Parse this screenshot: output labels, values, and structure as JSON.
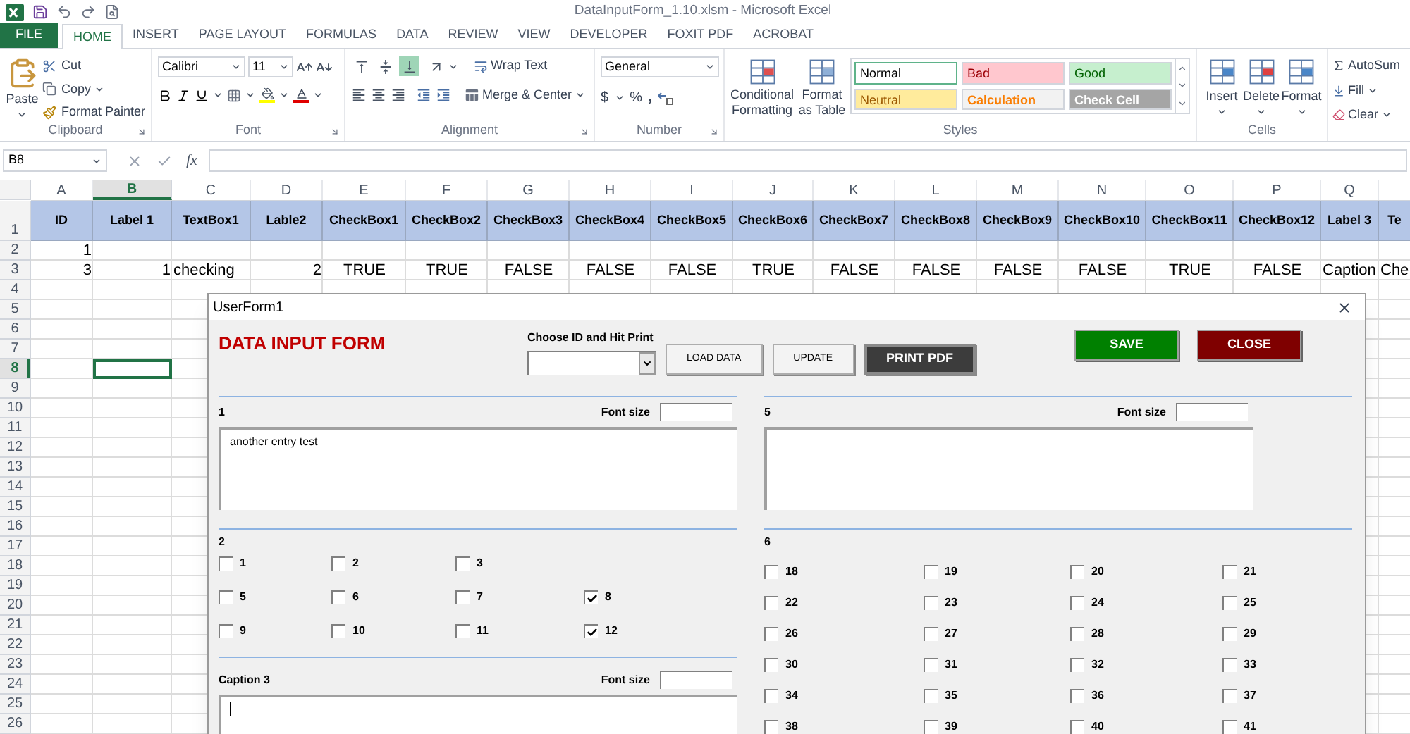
{
  "title_bar": {
    "title": "DataInputForm_1.10.xlsm - Microsoft Excel"
  },
  "ribbon_tabs": [
    {
      "label": "FILE",
      "kind": "file",
      "selected": false
    },
    {
      "label": "HOME",
      "kind": "tab",
      "selected": true
    },
    {
      "label": "INSERT",
      "kind": "tab",
      "selected": false
    },
    {
      "label": "PAGE LAYOUT",
      "kind": "tab",
      "selected": false
    },
    {
      "label": "FORMULAS",
      "kind": "tab",
      "selected": false
    },
    {
      "label": "DATA",
      "kind": "tab",
      "selected": false
    },
    {
      "label": "REVIEW",
      "kind": "tab",
      "selected": false
    },
    {
      "label": "VIEW",
      "kind": "tab",
      "selected": false
    },
    {
      "label": "DEVELOPER",
      "kind": "tab",
      "selected": false
    },
    {
      "label": "FOXIT PDF",
      "kind": "tab",
      "selected": false
    },
    {
      "label": "ACROBAT",
      "kind": "tab",
      "selected": false
    }
  ],
  "ribbon": {
    "clipboard": {
      "label": "Clipboard",
      "paste": "Paste",
      "cut": "Cut",
      "copy": "Copy",
      "format_painter": "Format Painter"
    },
    "font": {
      "label": "Font",
      "name": "Calibri",
      "size": "11"
    },
    "alignment": {
      "label": "Alignment",
      "wrap_text": "Wrap Text",
      "merge": "Merge & Center",
      "vertical_buttons": [
        {
          "kind": "top",
          "selected": false
        },
        {
          "kind": "middle",
          "selected": false
        },
        {
          "kind": "bottom",
          "selected": true
        }
      ]
    },
    "number": {
      "label": "Number",
      "format": "General",
      "currency": "$",
      "percent": "%",
      "comma": ","
    },
    "styles": {
      "label": "Styles",
      "conditional": "Conditional Formatting",
      "format_table": "Format as Table",
      "gallery": [
        {
          "label": "Normal",
          "kind": "normal",
          "selected": true
        },
        {
          "label": "Bad",
          "kind": "bad",
          "selected": false
        },
        {
          "label": "Good",
          "kind": "good",
          "selected": false
        },
        {
          "label": "Neutral",
          "kind": "neutral",
          "selected": false
        },
        {
          "label": "Calculation",
          "kind": "calculation",
          "selected": false
        },
        {
          "label": "Check Cell",
          "kind": "check",
          "selected": false
        }
      ]
    },
    "cells": {
      "label": "Cells",
      "insert": "Insert",
      "delete": "Delete",
      "format": "Format"
    },
    "editing": {
      "autosum": "AutoSum",
      "fill": "Fill",
      "clear": "Clear"
    }
  },
  "formula_bar": {
    "name_box": "B8",
    "fx": "fx"
  },
  "sheet": {
    "columns": [
      {
        "letter": "A",
        "selected": false
      },
      {
        "letter": "B",
        "selected": true
      },
      {
        "letter": "C",
        "selected": false
      },
      {
        "letter": "D",
        "selected": false
      },
      {
        "letter": "E",
        "selected": false
      },
      {
        "letter": "F",
        "selected": false
      },
      {
        "letter": "G",
        "selected": false
      },
      {
        "letter": "H",
        "selected": false
      },
      {
        "letter": "I",
        "selected": false
      },
      {
        "letter": "J",
        "selected": false
      },
      {
        "letter": "K",
        "selected": false
      },
      {
        "letter": "L",
        "selected": false
      },
      {
        "letter": "M",
        "selected": false
      },
      {
        "letter": "N",
        "selected": false
      },
      {
        "letter": "O",
        "selected": false
      },
      {
        "letter": "P",
        "selected": false
      },
      {
        "letter": "Q",
        "selected": false
      }
    ],
    "rows": [
      {
        "number": "1",
        "selected": false,
        "cells": [
          {
            "text": "ID",
            "kind": "header"
          },
          {
            "text": "Label 1",
            "kind": "header"
          },
          {
            "text": "TextBox1",
            "kind": "header"
          },
          {
            "text": "Lable2",
            "kind": "header"
          },
          {
            "text": "CheckBox1",
            "kind": "header"
          },
          {
            "text": "CheckBox2",
            "kind": "header"
          },
          {
            "text": "CheckBox3",
            "kind": "header"
          },
          {
            "text": "CheckBox4",
            "kind": "header"
          },
          {
            "text": "CheckBox5",
            "kind": "header"
          },
          {
            "text": "CheckBox6",
            "kind": "header"
          },
          {
            "text": "CheckBox7",
            "kind": "header"
          },
          {
            "text": "CheckBox8",
            "kind": "header"
          },
          {
            "text": "CheckBox9",
            "kind": "header"
          },
          {
            "text": "CheckBox10",
            "kind": "header"
          },
          {
            "text": "CheckBox11",
            "kind": "header"
          },
          {
            "text": "CheckBox12",
            "kind": "header"
          },
          {
            "text": "Label 3",
            "kind": "header"
          },
          {
            "text": "Te",
            "kind": "header"
          }
        ]
      },
      {
        "number": "2",
        "selected": false,
        "cells": [
          {
            "text": "1",
            "kind": "number"
          }
        ]
      },
      {
        "number": "3",
        "selected": false,
        "cells": [
          {
            "text": "3",
            "kind": "number"
          },
          {
            "text": "1",
            "kind": "number"
          },
          {
            "text": "checking",
            "kind": "text"
          },
          {
            "text": "2",
            "kind": "number"
          },
          {
            "text": "TRUE",
            "kind": "boolean"
          },
          {
            "text": "TRUE",
            "kind": "boolean"
          },
          {
            "text": "FALSE",
            "kind": "boolean"
          },
          {
            "text": "FALSE",
            "kind": "boolean"
          },
          {
            "text": "FALSE",
            "kind": "boolean"
          },
          {
            "text": "TRUE",
            "kind": "boolean"
          },
          {
            "text": "FALSE",
            "kind": "boolean"
          },
          {
            "text": "FALSE",
            "kind": "boolean"
          },
          {
            "text": "FALSE",
            "kind": "boolean"
          },
          {
            "text": "FALSE",
            "kind": "boolean"
          },
          {
            "text": "TRUE",
            "kind": "boolean"
          },
          {
            "text": "FALSE",
            "kind": "boolean"
          },
          {
            "text": "Caption",
            "kind": "text"
          },
          {
            "text": "Che",
            "kind": "text"
          }
        ]
      },
      {
        "number": "4",
        "selected": false
      },
      {
        "number": "5",
        "selected": false
      },
      {
        "number": "6",
        "selected": false
      },
      {
        "number": "7",
        "selected": false
      },
      {
        "number": "8",
        "selected": true
      },
      {
        "number": "9",
        "selected": false
      },
      {
        "number": "10",
        "selected": false
      },
      {
        "number": "11",
        "selected": false
      },
      {
        "number": "12",
        "selected": false
      },
      {
        "number": "13",
        "selected": false
      },
      {
        "number": "14",
        "selected": false
      },
      {
        "number": "15",
        "selected": false
      },
      {
        "number": "16",
        "selected": false
      },
      {
        "number": "17",
        "selected": false
      },
      {
        "number": "18",
        "selected": false
      },
      {
        "number": "19",
        "selected": false
      },
      {
        "number": "20",
        "selected": false
      },
      {
        "number": "21",
        "selected": false
      },
      {
        "number": "22",
        "selected": false
      },
      {
        "number": "23",
        "selected": false
      },
      {
        "number": "24",
        "selected": false
      },
      {
        "number": "25",
        "selected": false
      },
      {
        "number": "26",
        "selected": false
      }
    ]
  },
  "userform": {
    "title": "UserForm1",
    "heading": "DATA INPUT FORM",
    "choose_label": "Choose ID and Hit Print",
    "buttons": [
      {
        "label": "LOAD DATA",
        "kind": "plain"
      },
      {
        "label": "UPDATE",
        "kind": "plain"
      },
      {
        "label": "PRINT PDF",
        "kind": "dark"
      }
    ],
    "save": "SAVE",
    "close": "CLOSE",
    "left_column": [
      {
        "kind": "text",
        "caption": "1",
        "font_size_label": "Font size",
        "value": "another entry test",
        "focused": false
      },
      {
        "kind": "checkboxes",
        "caption": "2",
        "rows": [
          [
            {
              "label": "1",
              "checked": false
            },
            {
              "label": "2",
              "checked": false
            },
            {
              "label": "3",
              "checked": false
            }
          ],
          [
            {
              "label": "5",
              "checked": false
            },
            {
              "label": "6",
              "checked": false
            },
            {
              "label": "7",
              "checked": false
            },
            {
              "label": "8",
              "checked": true
            }
          ],
          [
            {
              "label": "9",
              "checked": false
            },
            {
              "label": "10",
              "checked": false
            },
            {
              "label": "11",
              "checked": false
            },
            {
              "label": "12",
              "checked": true
            }
          ]
        ]
      },
      {
        "kind": "text",
        "caption": "Caption 3",
        "font_size_label": "Font size",
        "focused": true
      }
    ],
    "right_column": [
      {
        "kind": "text",
        "caption": "5",
        "font_size_label": "Font size",
        "focused": false
      },
      {
        "kind": "checkboxes",
        "caption": "6",
        "rows": [
          [
            {
              "label": "18",
              "checked": false
            },
            {
              "label": "19",
              "checked": false
            },
            {
              "label": "20",
              "checked": false
            },
            {
              "label": "21",
              "checked": false
            }
          ],
          [
            {
              "label": "22",
              "checked": false
            },
            {
              "label": "23",
              "checked": false
            },
            {
              "label": "24",
              "checked": false
            },
            {
              "label": "25",
              "checked": false
            }
          ],
          [
            {
              "label": "26",
              "checked": false
            },
            {
              "label": "27",
              "checked": false
            },
            {
              "label": "28",
              "checked": false
            },
            {
              "label": "29",
              "checked": false
            }
          ],
          [
            {
              "label": "30",
              "checked": false
            },
            {
              "label": "31",
              "checked": false
            },
            {
              "label": "32",
              "checked": false
            },
            {
              "label": "33",
              "checked": false
            }
          ],
          [
            {
              "label": "34",
              "checked": false
            },
            {
              "label": "35",
              "checked": false
            },
            {
              "label": "36",
              "checked": false
            },
            {
              "label": "37",
              "checked": false
            }
          ],
          [
            {
              "label": "38",
              "checked": false
            },
            {
              "label": "39",
              "checked": false
            },
            {
              "label": "40",
              "checked": false
            },
            {
              "label": "41",
              "checked": false
            }
          ]
        ]
      }
    ]
  }
}
